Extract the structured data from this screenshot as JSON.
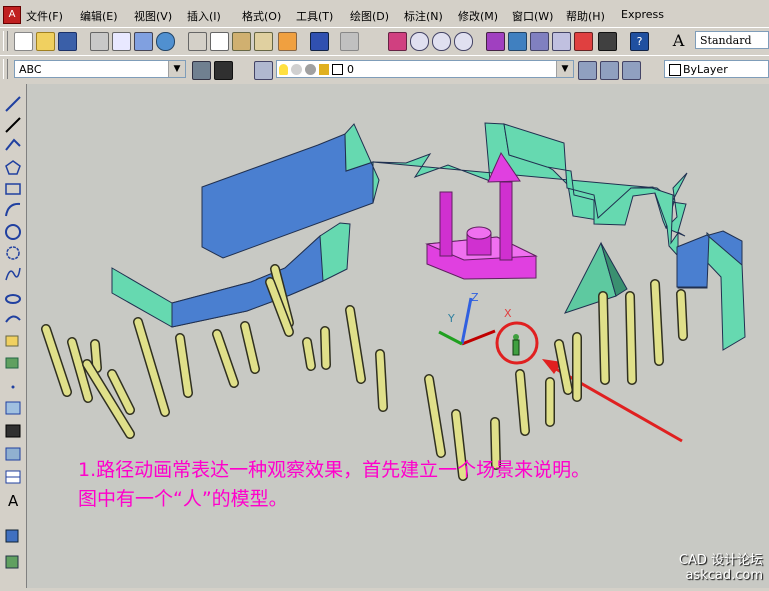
{
  "menu": [
    "文件(F)",
    "编辑(E)",
    "视图(V)",
    "插入(I)",
    "格式(O)",
    "工具(T)",
    "绘图(D)",
    "标注(N)",
    "修改(M)",
    "窗口(W)",
    "帮助(H)",
    "Express"
  ],
  "toolbar": {
    "text_style": "Standard"
  },
  "properties": {
    "layer_value": "ABC",
    "layer_number": "0",
    "color": "ByLayer"
  },
  "canvas": {
    "axes": {
      "x": "X",
      "y": "Y",
      "z": "Z"
    },
    "caption_line1": "1.路径动画常表达一种观察效果，首先建立一个场景来说明。",
    "caption_line2": "图中有一个“人”的模型。",
    "watermark_line1": "CAD 设计论坛",
    "watermark_line2": "askcad.com"
  },
  "colors": {
    "caption": "#ff00cc",
    "wall_front": "#4a7fd0",
    "wall_side": "#66d9b0",
    "post": "#e0e08a",
    "pink": "#e040e0",
    "arrow": "#e02020"
  }
}
